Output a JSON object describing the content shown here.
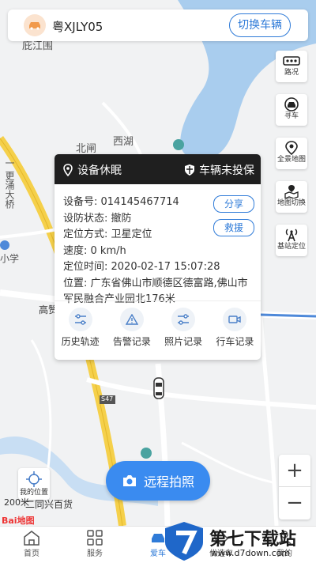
{
  "header": {
    "plate": "粤XJLY05",
    "switch_label": "切换车辆"
  },
  "tools": [
    {
      "name": "traffic",
      "label": "路况",
      "icon": "traffic-icon"
    },
    {
      "name": "find-car",
      "label": "寻车",
      "icon": "car-icon"
    },
    {
      "name": "panorama",
      "label": "全景地图",
      "icon": "pin-icon"
    },
    {
      "name": "map-switch",
      "label": "地图切换",
      "icon": "map-switch-icon"
    },
    {
      "name": "station",
      "label": "基站定位",
      "icon": "antenna-icon"
    }
  ],
  "map_labels": {
    "a": "庇江围",
    "b": "北闸",
    "c": "西湖",
    "d": "一 更涌大桥",
    "e": "小学",
    "f": "高赞",
    "g": "S47",
    "h": "二同兴百货"
  },
  "popup": {
    "status": "设备休眠",
    "defense": "车辆未投保",
    "device_no": "设备号: 014145467714",
    "arm_state": "设防状态: 撤防",
    "loc_mode": "定位方式: 卫星定位",
    "speed": "速度: 0  km/h",
    "loc_time": "定位时间: 2020-02-17 15:07:28",
    "address": "位置: 广东省佛山市顺德区德富路,佛山市军民融合产业园北176米",
    "share": "分享",
    "rescue": "救援",
    "actions": [
      "历史轨迹",
      "告警记录",
      "照片记录",
      "行车记录"
    ]
  },
  "locate_label": "我的位置",
  "photo_button": "远程拍照",
  "scale": "200米",
  "baidu": "Bai地图",
  "zoom": {
    "in": "+",
    "out": "−"
  },
  "tabs": [
    "首页",
    "服务",
    "爱车",
    "优选车",
    "我的"
  ],
  "watermark": {
    "title": "第七下载站",
    "url": "www.d7down.com"
  },
  "colors": {
    "accent": "#2f7bd8",
    "button": "#3a8bf0",
    "road": "#f5d04a",
    "water": "#a9cdee"
  }
}
